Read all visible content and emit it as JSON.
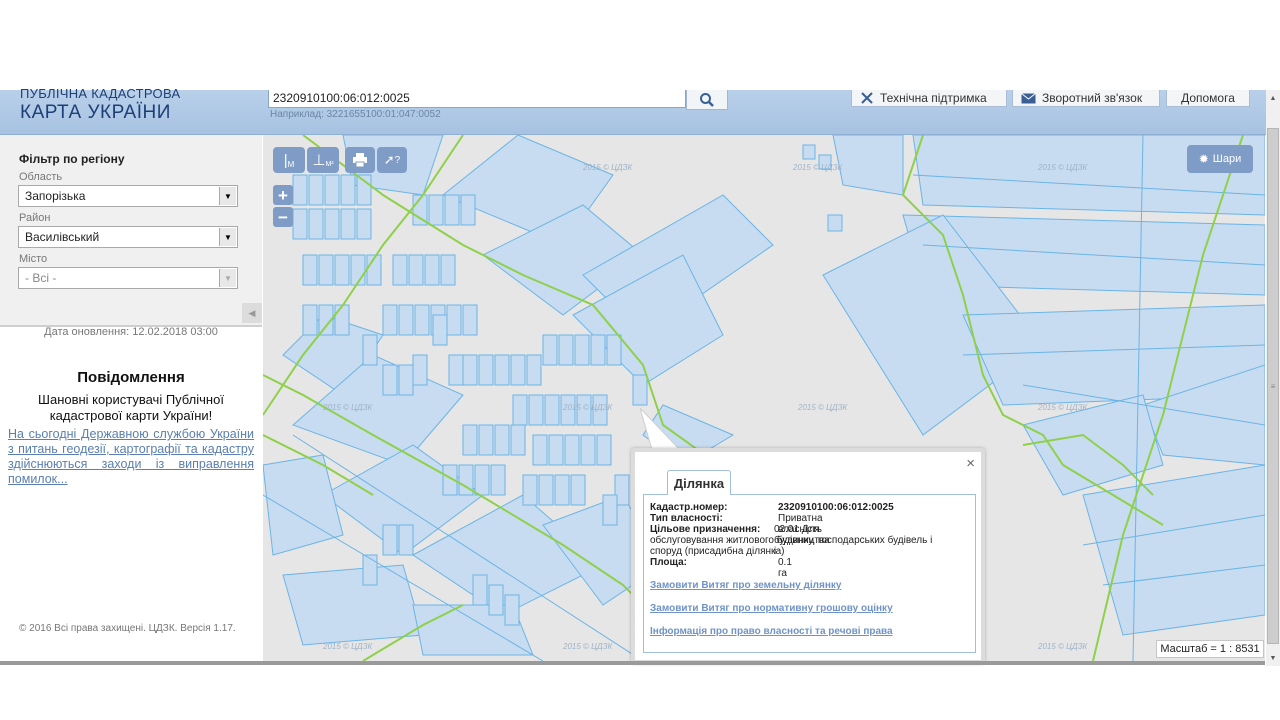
{
  "header": {
    "logo_line1": "ПУБЛІЧНА КАДАСТРОВА",
    "logo_line2": "КАРТА УКРАЇНИ",
    "search_value": "2320910100:06:012:0025",
    "search_example": "Наприклад: 3221655100:01:047:0052",
    "buttons": [
      {
        "label": "Технічна підтримка",
        "icon": "tools-icon"
      },
      {
        "label": "Зворотний зв'язок",
        "icon": "envelope-icon"
      },
      {
        "label": "Допомога",
        "icon": ""
      }
    ]
  },
  "sidebar": {
    "filter_title": "Фільтр по регіону",
    "oblast_label": "Область",
    "oblast_value": "Запорізька",
    "rayon_label": "Район",
    "rayon_value": "Василівський",
    "misto_label": "Місто",
    "misto_value": "- Всі -",
    "update_date": "Дата оновлення: 12.02.2018 03:00",
    "notif_title": "Повідомлення",
    "notif_greeting": "Шановні користувачі Публічної кадастрової карти України!",
    "notif_link": "На сьогодні Державною службою України з питань геодезії, картографії та кадастру здійснюються заходи із виправлення помилок...",
    "copyright": "© 2016 Всі права захищені. ЦДЗК. Версія 1.17."
  },
  "map": {
    "tools": [
      {
        "label": "M",
        "icon": "measure-length-icon"
      },
      {
        "label": "M²",
        "icon": "measure-area-icon"
      },
      {
        "label": "",
        "icon": "print-icon"
      },
      {
        "label": "?",
        "icon": "identify-icon"
      }
    ],
    "zoom_in": "+",
    "zoom_out": "−",
    "layers_label": "Шари",
    "watermark": "2015 © ЦДЗК",
    "scale_label": "Масштаб = 1 : 8531",
    "colors": {
      "parcel_fill": "#c7dcf0",
      "parcel_stroke": "#6bb4e6",
      "boundary": "#8fd04a",
      "background": "#e6e6e6"
    }
  },
  "popup": {
    "tab_label": "Ділянка",
    "close": "×",
    "rows": [
      {
        "key": "Кадастр.номер:",
        "value": "2320910100:06:012:0025"
      },
      {
        "key": "Тип власності:",
        "value": "Приватна власність"
      },
      {
        "key": "Цільове призначення:",
        "value": "02.01 Для будівництва і"
      },
      {
        "key": "",
        "value": "обслуговування житлового будинку, господарських будівель і"
      },
      {
        "key": "",
        "value": "споруд (присадибна ділянка)"
      },
      {
        "key": "Площа:",
        "value": "0.1 га"
      }
    ],
    "links": [
      "Замовити Витяг про земельну ділянку",
      "Замовити Витяг про нормативну грошову оцінку",
      "Інформація про право власності та речові права"
    ]
  }
}
